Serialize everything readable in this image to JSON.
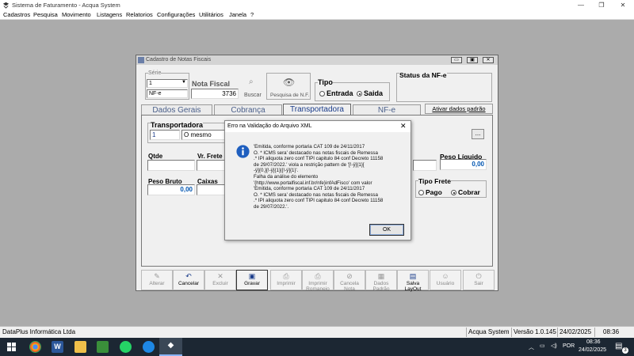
{
  "window": {
    "title": "Sistema de Faturamento - Acqua System"
  },
  "menu": [
    "Cadastros",
    "Pesquisa",
    "Movimento",
    "Listagens",
    "Relatorios",
    "Configurações",
    "Utilitários",
    "Janela",
    "?"
  ],
  "form": {
    "title": "Cadastro de Notas Fiscais",
    "serie_label": "Série",
    "serie_value": "1",
    "serie_type": "NF-e",
    "nota_label": "Nota Fiscal",
    "nota_value": "3736",
    "buscar_label": "Buscar",
    "pesquisa_label": "Pesquisa de N.F.",
    "tipo_label": "Tipo",
    "entrada_label": "Entrada",
    "saida_label": "Saida",
    "status_label": "Status da NF-e",
    "tabs": [
      "Dados Gerais",
      "Cobrança",
      "Transportadora",
      "NF-e"
    ],
    "active_tab": "Transportadora",
    "ativar_label": "Ativar dados padrão",
    "transportadora_label": "Transportadora",
    "transp_code": "1",
    "transp_name": "O mesmo",
    "browse_label": "...",
    "qtde_label": "Qtde",
    "vr_frete_label": "Vr. Frete",
    "peso_liquido_label": "Peso Líquido",
    "peso_liquido_value": "0,00",
    "peso_bruto_label": "Peso Bruto",
    "peso_bruto_value": "0,00",
    "caixas_label": "Caixas",
    "tipo_frete_label": "Tipo Frete",
    "pago_label": "Pago",
    "cobrar_label": "Cobrar"
  },
  "toolbar": [
    {
      "label": "Alterar",
      "icon": "edit-icon",
      "enabled": false
    },
    {
      "label": "Cancelar",
      "icon": "undo-icon",
      "enabled": true
    },
    {
      "label": "Excluir",
      "icon": "delete-icon",
      "enabled": false
    },
    {
      "label": "Gravar",
      "icon": "save-icon",
      "enabled": true
    },
    {
      "label": "Imprimir",
      "icon": "print-icon",
      "enabled": false
    },
    {
      "label": "Imprimir Romaneio",
      "icon": "print-icon",
      "enabled": false
    },
    {
      "label": "Cancela Nota",
      "icon": "cancel-icon",
      "enabled": false
    },
    {
      "label": "Dados Padrão",
      "icon": "defaults-icon",
      "enabled": false
    },
    {
      "label": "Salva LayOut",
      "icon": "layout-icon",
      "enabled": true
    },
    {
      "label": "Usuário",
      "icon": "user-icon",
      "enabled": false
    },
    {
      "label": "Sair",
      "icon": "exit-icon",
      "enabled": false
    }
  ],
  "dialog": {
    "title": "Erro na Validação do Arquivo XML",
    "message": "'Emitida, conforme portaria CAT 109 de 24/11/2017\nO. * ICMS sera' destacado nas notas fiscais de Remessa\n.* IPI aliquota zero conf TIPI capitulo 84 conf Decreto 11158\nde 29/07/2022.' viola a restrição pattern de '[!-ÿ]{1}[\n-ÿ]{0,}[!-ÿ]{1}|[!-ÿ]{1}'.\nFalha da análise do elemento\n'{http://www.portalfiscal.inf.br/nfe}infAdFisco' com valor\n'Emitida, conforme portaria CAT 109 de 24/11/2017\nO. * ICMS sera' destacado nas notas fiscais de Remessa\n.* IPI aliquota zero conf TIPI capitulo 84 conf Decreto 11158\nde 29/07/2022.'.",
    "ok_label": "OK",
    "close_label": "✕"
  },
  "status": {
    "company": "DataPlus Informática Ltda",
    "system": "Acqua System",
    "version": "Versão 1.0.145",
    "date": "24/02/2025",
    "time": "08:36"
  },
  "taskbar": {
    "lang": "POR",
    "time": "08:36",
    "date": "24/02/2025",
    "notif": "3"
  }
}
